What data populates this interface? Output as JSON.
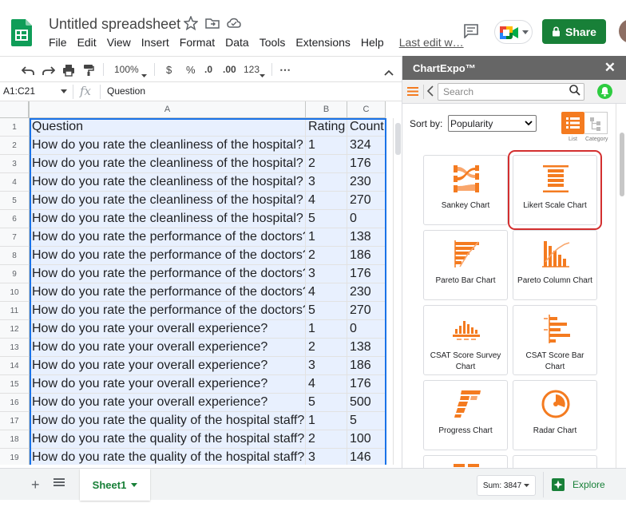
{
  "doc": {
    "title": "Untitled spreadsheet",
    "menu": [
      "File",
      "Edit",
      "View",
      "Insert",
      "Format",
      "Data",
      "Tools",
      "Extensions",
      "Help"
    ],
    "last_edit": "Last edit w…",
    "share_label": "Share"
  },
  "toolbar": {
    "zoom": "100%",
    "currency": "$",
    "percent": "%",
    "dec_less": ".0",
    "dec_more": ".00",
    "format_more": "123",
    "more": "⋯"
  },
  "formula_bar": {
    "name_box": "A1:C21",
    "fx": "fx",
    "value": "Question"
  },
  "grid": {
    "columns": [
      "A",
      "B",
      "C"
    ],
    "rows": [
      {
        "n": "1",
        "a": "Question",
        "b": "Rating",
        "c": "Count"
      },
      {
        "n": "2",
        "a": "How do you rate the cleanliness of the hospital?",
        "b": "1",
        "c": "324"
      },
      {
        "n": "3",
        "a": "How do you rate the cleanliness of the hospital?",
        "b": "2",
        "c": "176"
      },
      {
        "n": "4",
        "a": "How do you rate the cleanliness of the hospital?",
        "b": "3",
        "c": "230"
      },
      {
        "n": "5",
        "a": "How do you rate the cleanliness of the hospital?",
        "b": "4",
        "c": "270"
      },
      {
        "n": "6",
        "a": "How do you rate the cleanliness of the hospital?",
        "b": "5",
        "c": "0"
      },
      {
        "n": "7",
        "a": "How do you rate the performance of the doctors?",
        "b": "1",
        "c": "138"
      },
      {
        "n": "8",
        "a": "How do you rate the performance of the doctors?",
        "b": "2",
        "c": "186"
      },
      {
        "n": "9",
        "a": "How do you rate the performance of the doctors?",
        "b": "3",
        "c": "176"
      },
      {
        "n": "10",
        "a": "How do you rate the performance of the doctors?",
        "b": "4",
        "c": "230"
      },
      {
        "n": "11",
        "a": "How do you rate the performance of the doctors?",
        "b": "5",
        "c": "270"
      },
      {
        "n": "12",
        "a": "How do you rate your overall experience?",
        "b": "1",
        "c": "0"
      },
      {
        "n": "13",
        "a": "How do you rate your overall experience?",
        "b": "2",
        "c": "138"
      },
      {
        "n": "14",
        "a": "How do you rate your overall experience?",
        "b": "3",
        "c": "186"
      },
      {
        "n": "15",
        "a": "How do you rate your overall experience?",
        "b": "4",
        "c": "176"
      },
      {
        "n": "16",
        "a": "How do you rate your overall experience?",
        "b": "5",
        "c": "500"
      },
      {
        "n": "17",
        "a": "How do you rate the quality of the hospital staff?",
        "b": "1",
        "c": "5"
      },
      {
        "n": "18",
        "a": "How do you rate the quality of the hospital staff?",
        "b": "2",
        "c": "100"
      },
      {
        "n": "19",
        "a": "How do you rate the quality of the hospital staff?",
        "b": "3",
        "c": "146"
      }
    ]
  },
  "bottom": {
    "sheet_name": "Sheet1",
    "sum": "Sum: 3847",
    "explore": "Explore"
  },
  "panel": {
    "title": "ChartExpo™",
    "search_placeholder": "Search",
    "sort_label": "Sort by:",
    "sort_value": "Popularity",
    "view_list": "List",
    "view_category": "Category",
    "accent": "#f47b20",
    "charts": [
      {
        "label": "Sankey Chart",
        "icon": "sankey-icon"
      },
      {
        "label": "Likert Scale Chart",
        "icon": "likert-icon",
        "highlighted": true
      },
      {
        "label": "Pareto Bar Chart",
        "icon": "pareto-bar-icon"
      },
      {
        "label": "Pareto Column Chart",
        "icon": "pareto-column-icon"
      },
      {
        "label": "CSAT Score Survey Chart",
        "icon": "csat-survey-icon"
      },
      {
        "label": "CSAT Score Bar Chart",
        "icon": "csat-bar-icon"
      },
      {
        "label": "Progress Chart",
        "icon": "progress-icon"
      },
      {
        "label": "Radar Chart",
        "icon": "radar-icon"
      }
    ]
  }
}
